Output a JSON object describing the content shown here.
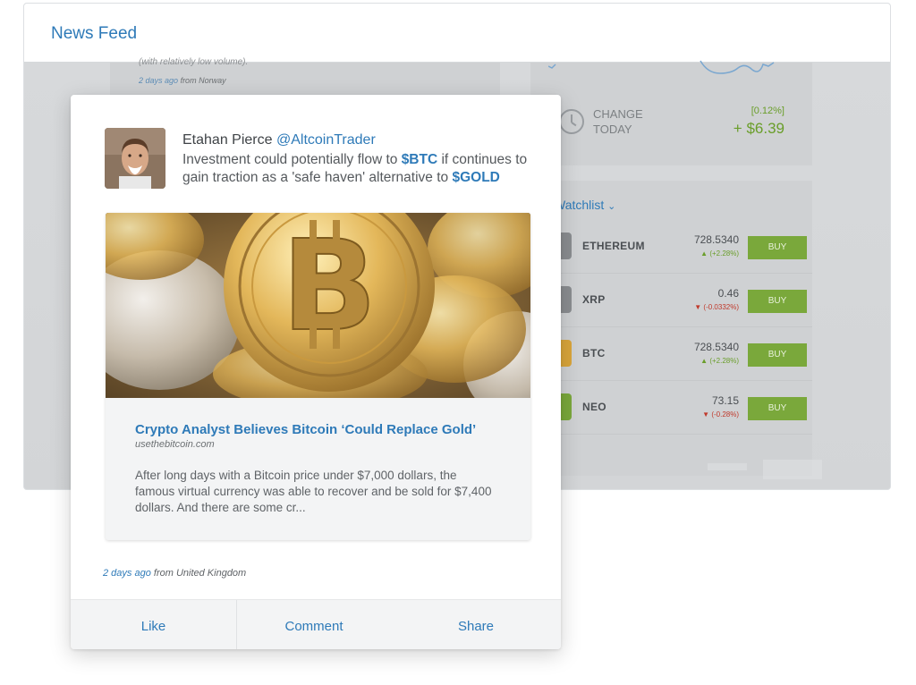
{
  "header": {
    "title": "News Feed"
  },
  "background_post": {
    "text": "(with relatively low volume).",
    "time_ago": "2 days ago",
    "location": "from Norway"
  },
  "market_summary": {
    "change_label_line1": "CHANGE",
    "change_label_line2": "TODAY",
    "change_percent": "[0.12%]",
    "change_value": "+ $6.39"
  },
  "watchlist": {
    "title": "Watchlist",
    "dropdown_icon": "chevron-down-icon",
    "buy_label": "BUY",
    "rows": [
      {
        "name": "ETHEREUM",
        "price": "728.5340",
        "delta": "(+2.28%)",
        "direction": "up",
        "icon_color": "#8a8d90"
      },
      {
        "name": "XRP",
        "price": "0.46",
        "delta": "(-0.0332%)",
        "direction": "down",
        "icon_color": "#8a8d90"
      },
      {
        "name": "BTC",
        "price": "728.5340",
        "delta": "(+2.28%)",
        "direction": "up",
        "icon_color": "#d9a53a"
      },
      {
        "name": "NEO",
        "price": "73.15",
        "delta": "(-0.28%)",
        "direction": "down",
        "icon_color": "#7aa83b"
      }
    ]
  },
  "post": {
    "author": "Etahan Pierce",
    "handle": "@AltcoinTrader",
    "text_part1": "Investment could potentially flow to ",
    "tag1": "$BTC",
    "text_part2": " if continues to gain traction as a 'safe haven' alternative to ",
    "tag2": "$GOLD",
    "link": {
      "title": "Crypto Analyst Believes Bitcoin ‘Could Replace Gold’",
      "source": "usethebitcoin.com",
      "description": "After long days with a Bitcoin price under $7,000 dollars, the famous virtual currency was able to recover and be sold for $7,400 dollars. And there are some cr..."
    },
    "time_ago": "2 days ago",
    "location": "from United Kingdom",
    "actions": {
      "like": "Like",
      "comment": "Comment",
      "share": "Share"
    }
  },
  "colors": {
    "accent_blue": "#2e7ab8",
    "positive_green": "#6a9e2a",
    "negative_red": "#c0392b",
    "buy_button": "#7aa83b"
  }
}
